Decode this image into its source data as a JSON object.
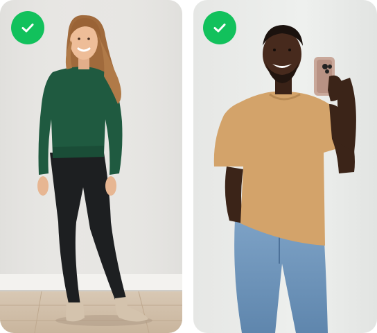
{
  "cards": [
    {
      "badge_icon": "check-icon",
      "badge_color": "#12C15C",
      "photo_subject": "woman-full-body-photo",
      "background_color": "#e9e8e5"
    },
    {
      "badge_icon": "check-icon",
      "badge_color": "#12C15C",
      "photo_subject": "man-mirror-selfie-photo",
      "background_color": "#e8e9e7"
    }
  ]
}
